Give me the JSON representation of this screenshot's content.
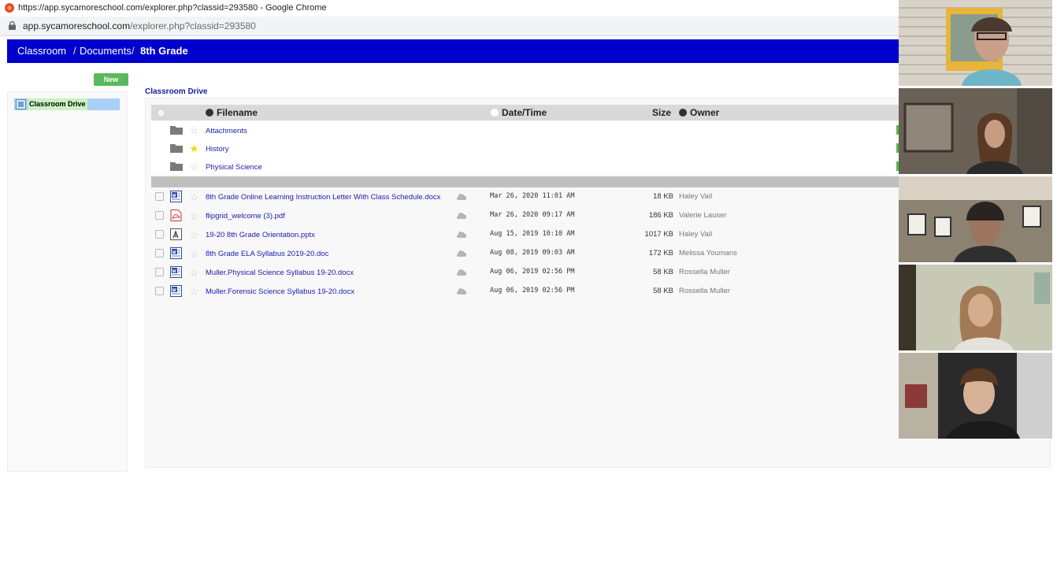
{
  "browser": {
    "window_title": "https://app.sycamoreschool.com/explorer.php?classid=293580 - Google Chrome",
    "url_host": "app.sycamoreschool.com",
    "url_path": "/explorer.php?classid=293580"
  },
  "breadcrumb": {
    "items": [
      "Classroom",
      "Documents",
      "8th Grade"
    ],
    "separator": "/"
  },
  "toolbar": {
    "new_label": "New"
  },
  "tree": {
    "root_label": "Classroom Drive"
  },
  "main": {
    "title": "Classroom Drive",
    "columns": {
      "filename": "Filename",
      "datetime": "Date/Time",
      "size": "Size",
      "owner": "Owner"
    },
    "folders": [
      {
        "name": "Attachments",
        "starred": false
      },
      {
        "name": "History",
        "starred": true
      },
      {
        "name": "Physical Science",
        "starred": false
      }
    ],
    "files": [
      {
        "name": "8th Grade Online Learning Instruction Letter With Class Schedule.docx",
        "type": "word",
        "date": "Mar 26, 2020 11:01 AM",
        "size": "18 KB",
        "owner": "Haley Vail"
      },
      {
        "name": "flipgrid_welcome (3).pdf",
        "type": "pdf",
        "date": "Mar 26, 2020 09:17 AM",
        "size": "186 KB",
        "owner": "Valerie Lauser"
      },
      {
        "name": "19-20 8th Grade Orientation.pptx",
        "type": "powerpoint",
        "date": "Aug 15, 2019 10:10 AM",
        "size": "1017 KB",
        "owner": "Haley Vail"
      },
      {
        "name": "8th Grade ELA Syllabus 2019-20.doc",
        "type": "word",
        "date": "Aug 08, 2019 09:03 AM",
        "size": "172 KB",
        "owner": "Melissa Youmans"
      },
      {
        "name": "Muller.Physical Science Syllabus 19-20.docx",
        "type": "word",
        "date": "Aug 06, 2019 02:56 PM",
        "size": "58 KB",
        "owner": "Rossella Muller"
      },
      {
        "name": "Muller.Forensic Science Syllabus 19-20.docx",
        "type": "word",
        "date": "Aug 06, 2019 02:56 PM",
        "size": "58 KB",
        "owner": "Rossella Muller"
      }
    ]
  },
  "colors": {
    "breadcrumb_bg": "#0000cc",
    "new_button": "#5cb85c",
    "link": "#1a1ab0",
    "star_active": "#f2d600",
    "tree_selected": "#a8d0f8"
  }
}
